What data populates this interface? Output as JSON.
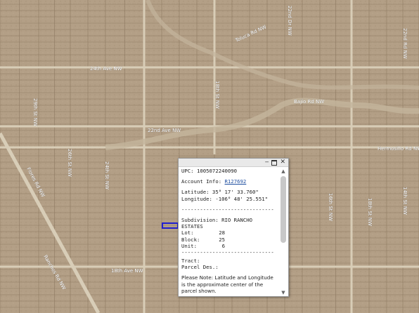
{
  "roads": {
    "r24th": "24th Ave NW",
    "r22nd": "22nd Ave NW",
    "hermosillo": "Hermosillo Rd NW",
    "bajio": "Bajío Rd NW",
    "toluca": "Toluca Rd NW",
    "r18th": "18th Ave NW",
    "flores": "Flores Rd NW",
    "s24th": "24th St NW",
    "s26th": "26th St NW",
    "s29th": "29th St NW",
    "ranchos": "Ranchos Rd NW",
    "s18th_upper": "18th St NW",
    "s18th_right": "18th St NW",
    "s14th": "14th St NW",
    "s16th": "16th St NW",
    "dr22nd": "22nd Dr NW",
    "rd22nd": "22nd Rd NW"
  },
  "popup": {
    "upc": "UPC: 1005072240090",
    "account_label": "Account Info: ",
    "account_link": "R127692",
    "latitude": "Latitude: 35° 17' 33.760\"",
    "longitude": "Longitude: -106° 48' 25.551\"",
    "divider": "------------------------------",
    "subdivision": "Subdivision: RIO RANCHO",
    "subdivision_cont": "ESTATES",
    "lot_label": "Lot:",
    "lot_value": "28",
    "block_label": "Block:",
    "block_value": "25",
    "unit_label": "Unit:",
    "unit_value": "6",
    "tract": "Tract:",
    "parcel_des": "Parcel Des.:",
    "note": "Please Note: Latitude and Longitude is the approximate center of the parcel shown."
  },
  "colors": {
    "map_bg": "#b39f86",
    "parcel_line": "#8e7a62",
    "major_road": "#d8cdb7",
    "wash": "#c4b59c",
    "selection": "#2020d0"
  }
}
